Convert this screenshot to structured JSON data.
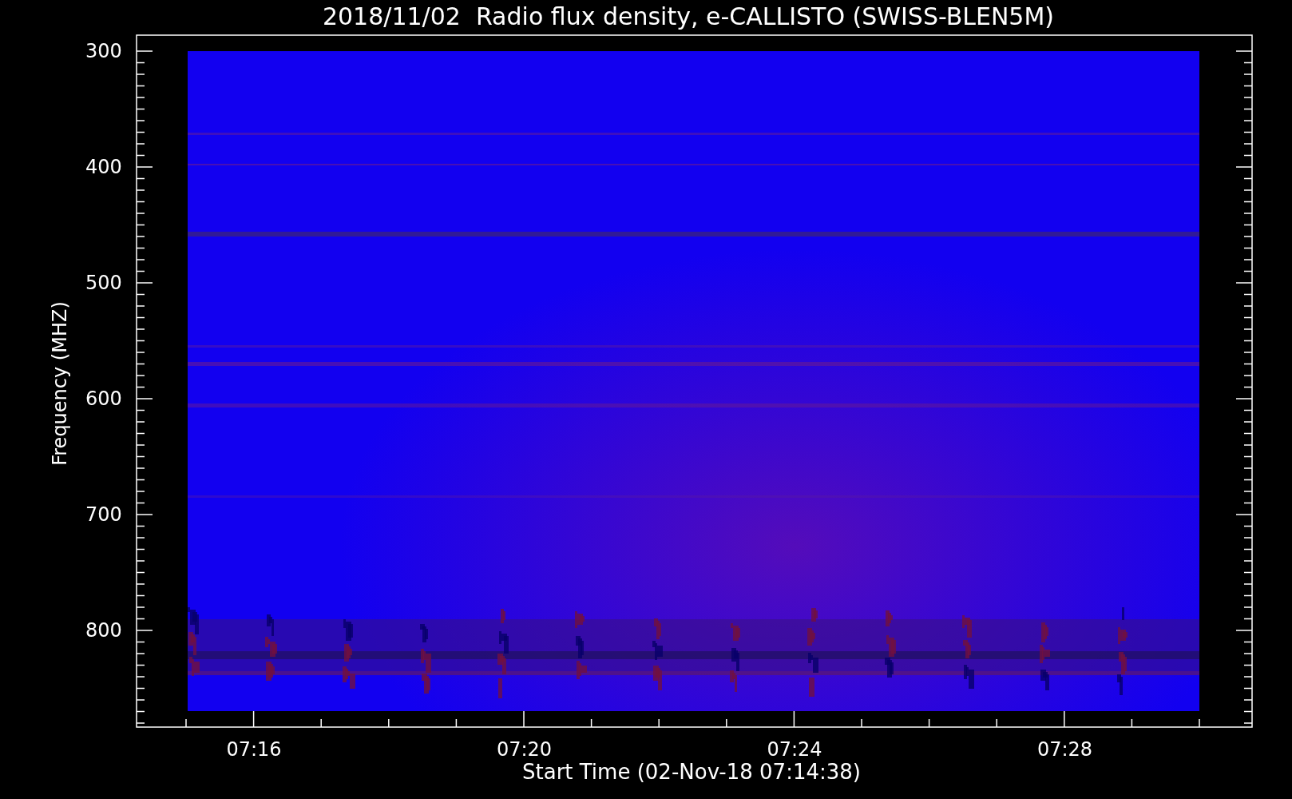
{
  "title": "2018/11/02  Radio flux density, e-CALLISTO (SWISS-BLEN5M)",
  "y_axis": {
    "label": "Frequency (MHZ)",
    "ticks": [
      "300",
      "400",
      "500",
      "600",
      "700",
      "800"
    ]
  },
  "x_axis": {
    "label": "Start Time (02-Nov-18 07:14:38)",
    "ticks": [
      "07:16",
      "07:20",
      "07:24",
      "07:28"
    ]
  }
}
